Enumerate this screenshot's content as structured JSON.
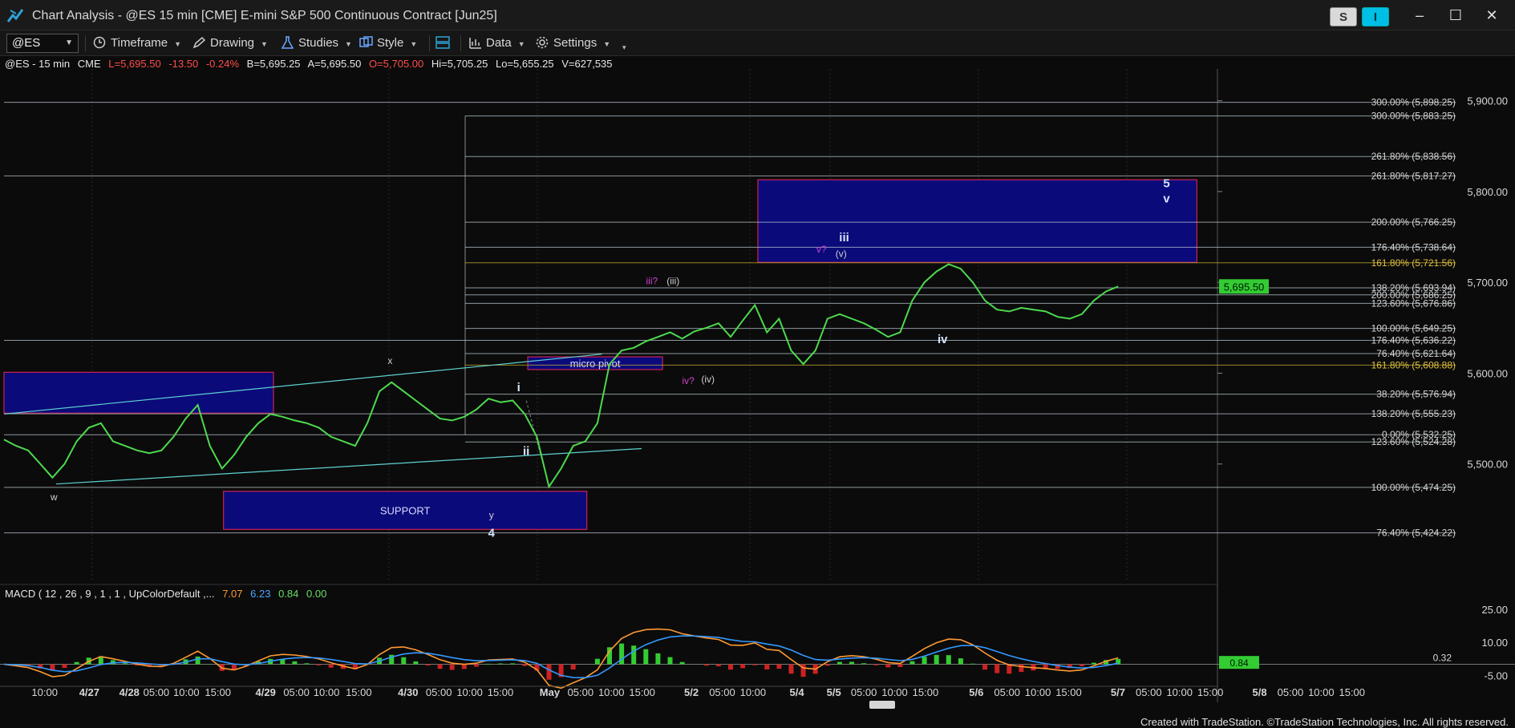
{
  "window": {
    "title": "Chart Analysis - @ES 15 min [CME] E-mini S&P 500 Continuous Contract [Jun25]",
    "s_button": "S",
    "i_button": "I",
    "minimize": "–",
    "maximize": "☐",
    "close": "✕"
  },
  "toolbar": {
    "symbol": "@ES",
    "timeframe": "Timeframe",
    "drawing": "Drawing",
    "studies": "Studies",
    "style": "Style",
    "data": "Data",
    "settings": "Settings"
  },
  "info": {
    "symbol": "@ES - 15 min",
    "exchange": "CME",
    "last": "L=5,695.50",
    "change": "-13.50",
    "pct": "-0.24%",
    "bid": "B=5,695.25",
    "ask": "A=5,695.50",
    "open": "O=5,705.00",
    "high": "Hi=5,705.25",
    "low": "Lo=5,655.25",
    "volume": "V=627,535"
  },
  "macd": {
    "label": "MACD ( 12 , 26 , 9 , 1 , 1 , UpColorDefault ,...",
    "v1": "7.07",
    "v2": "6.23",
    "v3": "0.84",
    "v4": "0.00"
  },
  "footer": "Created with TradeStation. ©TradeStation Technologies, Inc. All rights reserved.",
  "colors": {
    "background": "#0b0b0b",
    "price_line": "#4dd94d",
    "zone_fill": "#0a0a7a",
    "zone_border": "#cc2255",
    "fib_line": "#b8c6d0",
    "trendline": "#5fd0d0",
    "macd_line": "#ff9933",
    "signal_line": "#3399ff",
    "hist_pos": "#33cc33",
    "hist_neg": "#cc2222"
  },
  "chart_data": {
    "type": "line",
    "title": "",
    "xlabel": "",
    "ylabel": "",
    "ylim": [
      5370,
      5935
    ],
    "price_ticks": [
      "5,900.00",
      "5,800.00",
      "5,700.00",
      "5,600.00",
      "5,500.00"
    ],
    "last_price": "5,695.50",
    "time_labels": [
      "10:00",
      "4/27",
      "4/28",
      "05:00",
      "10:00",
      "15:00",
      "4/29",
      "05:00",
      "10:00",
      "15:00",
      "4/30",
      "05:00",
      "10:00",
      "15:00",
      "May",
      "05:00",
      "10:00",
      "15:00",
      "5/2",
      "05:00",
      "10:00",
      "5/4",
      "5/5",
      "05:00",
      "10:00",
      "15:00",
      "5/6",
      "05:00",
      "10:00",
      "15:00",
      "5/7",
      "05:00",
      "10:00",
      "15:00",
      "5/8",
      "05:00",
      "10:00",
      "15:00"
    ],
    "price_path": [
      [
        0,
        5527
      ],
      [
        0.8,
        5520
      ],
      [
        1.6,
        5515
      ],
      [
        2.4,
        5500
      ],
      [
        3.2,
        5485
      ],
      [
        4.0,
        5500
      ],
      [
        4.8,
        5525
      ],
      [
        5.6,
        5540
      ],
      [
        6.4,
        5545
      ],
      [
        7.2,
        5525
      ],
      [
        8.0,
        5520
      ],
      [
        8.8,
        5515
      ],
      [
        9.6,
        5512
      ],
      [
        10.4,
        5515
      ],
      [
        11.2,
        5530
      ],
      [
        12.0,
        5550
      ],
      [
        12.8,
        5565
      ],
      [
        13.6,
        5520
      ],
      [
        14.4,
        5495
      ],
      [
        15.2,
        5510
      ],
      [
        16.0,
        5530
      ],
      [
        16.8,
        5545
      ],
      [
        17.6,
        5555
      ],
      [
        18.4,
        5552
      ],
      [
        19.2,
        5548
      ],
      [
        20.0,
        5545
      ],
      [
        20.8,
        5540
      ],
      [
        21.6,
        5530
      ],
      [
        22.4,
        5525
      ],
      [
        23.2,
        5520
      ],
      [
        24.0,
        5545
      ],
      [
        24.8,
        5580
      ],
      [
        25.6,
        5590
      ],
      [
        26.4,
        5580
      ],
      [
        27.2,
        5570
      ],
      [
        28.0,
        5560
      ],
      [
        28.8,
        5550
      ],
      [
        29.6,
        5548
      ],
      [
        30.4,
        5552
      ],
      [
        31.2,
        5560
      ],
      [
        32.0,
        5572
      ],
      [
        32.8,
        5568
      ],
      [
        33.6,
        5570
      ],
      [
        34.4,
        5555
      ],
      [
        35.2,
        5530
      ],
      [
        36.0,
        5475
      ],
      [
        36.8,
        5495
      ],
      [
        37.6,
        5520
      ],
      [
        38.4,
        5525
      ],
      [
        39.2,
        5545
      ],
      [
        40.0,
        5610
      ],
      [
        40.8,
        5625
      ],
      [
        41.6,
        5628
      ],
      [
        42.4,
        5635
      ],
      [
        43.2,
        5640
      ],
      [
        44.0,
        5645
      ],
      [
        44.8,
        5638
      ],
      [
        45.6,
        5646
      ],
      [
        46.4,
        5650
      ],
      [
        47.2,
        5655
      ],
      [
        48.0,
        5640
      ],
      [
        48.8,
        5658
      ],
      [
        49.6,
        5675
      ],
      [
        50.4,
        5645
      ],
      [
        51.2,
        5660
      ],
      [
        52.0,
        5625
      ],
      [
        52.8,
        5610
      ],
      [
        53.6,
        5625
      ],
      [
        54.4,
        5660
      ],
      [
        55.2,
        5665
      ],
      [
        56.0,
        5660
      ],
      [
        56.8,
        5655
      ],
      [
        57.6,
        5648
      ],
      [
        58.4,
        5640
      ],
      [
        59.2,
        5645
      ],
      [
        60.0,
        5680
      ],
      [
        60.8,
        5700
      ],
      [
        61.6,
        5712
      ],
      [
        62.4,
        5720
      ],
      [
        63.2,
        5715
      ],
      [
        64.0,
        5700
      ],
      [
        64.8,
        5680
      ],
      [
        65.6,
        5670
      ],
      [
        66.4,
        5668
      ],
      [
        67.2,
        5672
      ],
      [
        68.0,
        5670
      ],
      [
        68.8,
        5668
      ],
      [
        69.6,
        5662
      ],
      [
        70.4,
        5660
      ],
      [
        71.2,
        5665
      ],
      [
        72.0,
        5680
      ],
      [
        72.8,
        5690
      ],
      [
        73.6,
        5695.5
      ]
    ],
    "fib_levels": [
      {
        "label": "300.00% (5,898.25)",
        "value": 5898.25
      },
      {
        "label": "300.00% (5,883.25)",
        "value": 5883.25
      },
      {
        "label": "261.80% (5,838.56)",
        "value": 5838.56
      },
      {
        "label": "261.80% (5,817.27)",
        "value": 5817.27
      },
      {
        "label": "200.00% (5,766.25)",
        "value": 5766.25
      },
      {
        "label": "176.40% (5,738.64)",
        "value": 5738.64
      },
      {
        "label": "161.80% (5,721.56)",
        "value": 5721.56
      },
      {
        "label": "138.20% (5,693.94)",
        "value": 5693.94
      },
      {
        "label": "200.00% (5,686.25)",
        "value": 5686.25
      },
      {
        "label": "123.60% (5,676.86)",
        "value": 5676.86
      },
      {
        "label": "100.00% (5,649.25)",
        "value": 5649.25
      },
      {
        "label": "176.40% (5,636.22)",
        "value": 5636.22
      },
      {
        "label": "76.40% (5,621.64)",
        "value": 5621.64
      },
      {
        "label": "161.80% (5,608.88)",
        "value": 5608.88
      },
      {
        "label": "38.20% (5,576.94)",
        "value": 5576.94
      },
      {
        "label": "138.20% (5,555.23)",
        "value": 5555.23
      },
      {
        "label": "0.00% (5,532.25)",
        "value": 5532.25
      },
      {
        "label": "123.60% (5,524.28)",
        "value": 5524.28
      },
      {
        "label": "100.00% (5,474.25)",
        "value": 5474.25
      },
      {
        "label": "76.40% (5,424.22)",
        "value": 5424.22
      }
    ],
    "zones": [
      {
        "label": "",
        "x0": 0,
        "x1": 17.8,
        "top": 5601,
        "bottom": 5556
      },
      {
        "label": "SUPPORT",
        "x0": 14.5,
        "x1": 38.5,
        "top": 5470,
        "bottom": 5428
      },
      {
        "label": "micro pivot",
        "x0": 34.6,
        "x1": 43.5,
        "top": 5618,
        "bottom": 5604
      },
      {
        "label": "",
        "x0": 49.8,
        "x1": 78.8,
        "top": 5813,
        "bottom": 5722
      }
    ],
    "wave_labels": [
      {
        "text": "w",
        "x": 3.3,
        "y": 5460
      },
      {
        "text": "x",
        "x": 25.5,
        "y": 5610
      },
      {
        "text": "y",
        "x": 32.2,
        "y": 5440
      },
      {
        "text": "4",
        "x": 32.2,
        "y": 5420
      },
      {
        "text": "i",
        "x": 34.0,
        "y": 5580
      },
      {
        "text": "ii",
        "x": 34.5,
        "y": 5510
      },
      {
        "text": "iii?",
        "x": 42.8,
        "y": 5698
      },
      {
        "text": "(iii)",
        "x": 44.2,
        "y": 5698
      },
      {
        "text": "iv?",
        "x": 45.2,
        "y": 5588
      },
      {
        "text": "(iv)",
        "x": 46.5,
        "y": 5590
      },
      {
        "text": "v?",
        "x": 54.0,
        "y": 5733
      },
      {
        "text": "(v)",
        "x": 55.3,
        "y": 5728
      },
      {
        "text": "iii",
        "x": 55.5,
        "y": 5745
      },
      {
        "text": "iv",
        "x": 62.0,
        "y": 5633
      },
      {
        "text": "5",
        "x": 76.8,
        "y": 5805
      },
      {
        "text": "v",
        "x": 76.8,
        "y": 5788
      }
    ],
    "macd_ticks": [
      "25.00",
      "10.00",
      "-5.00"
    ],
    "macd_marker": "0.32",
    "macd_hist_marker": "0.84"
  }
}
